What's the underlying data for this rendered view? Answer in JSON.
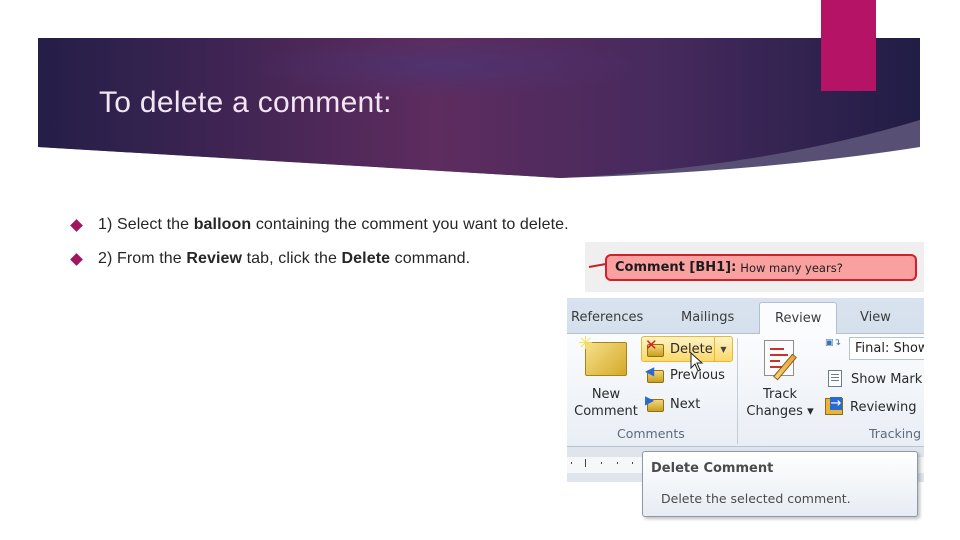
{
  "slide": {
    "title": "To delete a comment:",
    "colors": {
      "banner_dark": "#241e46",
      "banner_mid": "#5c2b5e",
      "accent": "#b51466",
      "bullet": "#a3145e"
    }
  },
  "bullets": [
    {
      "icon": "diamond-bullet-icon",
      "parts": [
        "1) Select the ",
        "balloon",
        " containing the comment you want to delete."
      ]
    },
    {
      "icon": "diamond-bullet-icon",
      "parts": [
        "2) From the ",
        "Review",
        " tab, click the ",
        "Delete",
        " command."
      ]
    }
  ],
  "screenshot": {
    "comment": {
      "label": "Comment [BH1]:",
      "text": "How many years?"
    },
    "ribbon": {
      "tabs": [
        {
          "label": "References",
          "active": false
        },
        {
          "label": "Mailings",
          "active": false
        },
        {
          "label": "Review",
          "active": true
        },
        {
          "label": "View",
          "active": false
        }
      ],
      "groups": {
        "comments": {
          "label": "Comments",
          "new_comment": [
            "New",
            "Comment"
          ],
          "delete": "Delete",
          "previous": "Previous",
          "next": "Next"
        },
        "tracking": {
          "label": "Tracking",
          "track_changes": [
            "Track",
            "Changes ▾"
          ],
          "display_for_review": "Final: Show",
          "show_markup": "Show Mark",
          "reviewing_pane": "Reviewing"
        }
      }
    },
    "tooltip": {
      "title": "Delete Comment",
      "body": "Delete the selected comment."
    }
  }
}
